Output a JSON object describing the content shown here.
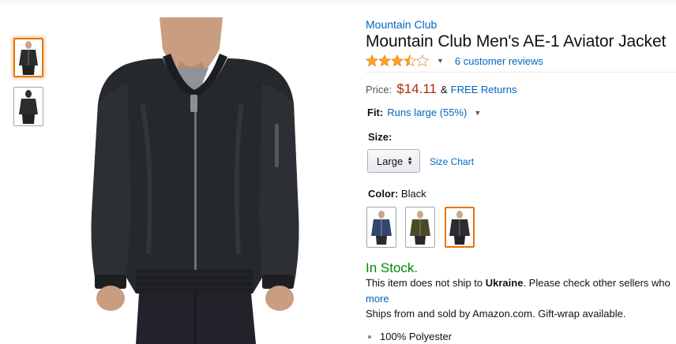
{
  "top_strip": {
    "faint_text": ""
  },
  "product": {
    "brand": "Mountain Club",
    "title": "Mountain Club Men's AE-1 Aviator Jacket",
    "rating": {
      "stars": 3.5,
      "max": 5,
      "reviews_label": "6 customer reviews"
    },
    "price": {
      "label": "Price:",
      "value": "$14.11",
      "amp": "&",
      "returns": "FREE Returns"
    },
    "fit": {
      "label": "Fit:",
      "value": "Runs large (55%)"
    },
    "size": {
      "label": "Size:",
      "selected": "Large",
      "chart_link": "Size Chart"
    },
    "color": {
      "label": "Color:",
      "selected": "Black",
      "swatches": [
        "navy",
        "olive",
        "black"
      ]
    },
    "availability": "In Stock.",
    "ship_note_prefix": "This item does not ship to ",
    "ship_note_country": "Ukraine",
    "ship_note_suffix": ". Please check other sellers who",
    "more_link": "more",
    "ships_from": "Ships from and sold by Amazon.com. Gift-wrap available.",
    "features": [
      "100% Polyester"
    ]
  },
  "colors": {
    "link": "#0066c0",
    "price": "#b12704",
    "in_stock": "#008a00",
    "star": "#ffa41c",
    "selected_border": "#e77600"
  }
}
